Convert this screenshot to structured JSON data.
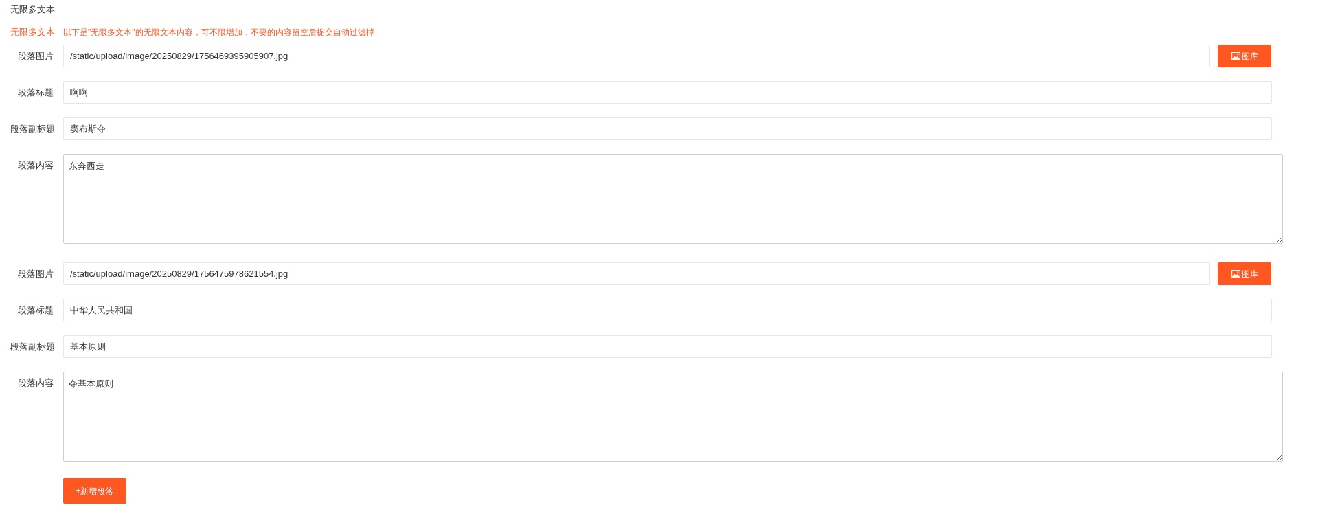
{
  "section_title": "无限多文本",
  "hint": {
    "label": "无限多文本",
    "text": "以下是\"无限多文本\"的无限文本内容，可不限增加，不要的内容留空后提交自动过滤掉"
  },
  "paragraphs": [
    {
      "fields": [
        {
          "kind": "image",
          "label": "段落图片",
          "value": "/static/upload/image/20250829/1756469395905907.jpg",
          "button": "图库"
        },
        {
          "kind": "text",
          "label": "段落标题",
          "value": "啊啊"
        },
        {
          "kind": "text",
          "label": "段落副标题",
          "value": "窦布斯夺"
        },
        {
          "kind": "textarea",
          "label": "段落内容",
          "value": "东奔西走"
        }
      ]
    },
    {
      "fields": [
        {
          "kind": "image",
          "label": "段落图片",
          "value": "/static/upload/image/20250829/1756475978621554.jpg",
          "button": "图库"
        },
        {
          "kind": "text",
          "label": "段落标题",
          "value": "中华人民共和国"
        },
        {
          "kind": "text",
          "label": "段落副标题",
          "value": "基本原则"
        },
        {
          "kind": "textarea",
          "label": "段落内容",
          "value": "夺基本原则"
        }
      ]
    }
  ],
  "add_button": "+新增段落"
}
